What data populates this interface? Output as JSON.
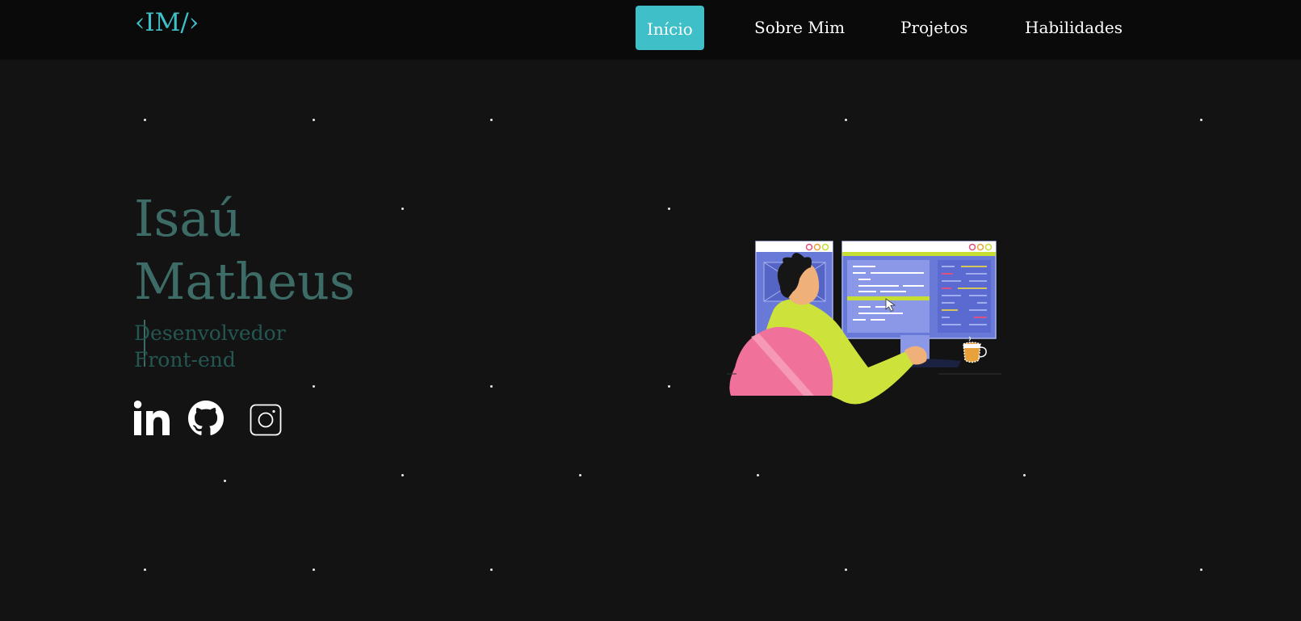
{
  "header": {
    "logo": "‹IM/›",
    "nav": [
      {
        "label": "Início",
        "active": true
      },
      {
        "label": "Sobre Mim",
        "active": false
      },
      {
        "label": "Projetos",
        "active": false
      },
      {
        "label": "Habilidades",
        "active": false
      }
    ]
  },
  "hero": {
    "name_first": "Isaú",
    "name_last": "Matheus",
    "role": "Desenvolvedor Front-end",
    "socials": [
      {
        "network": "LinkedIn",
        "icon": "linkedin-icon"
      },
      {
        "network": "GitHub",
        "icon": "github-icon"
      },
      {
        "network": "Instagram",
        "icon": "instagram-icon"
      }
    ]
  },
  "colors": {
    "accent": "#3fbfc7",
    "background": "#131313",
    "navbar": "#0a0a0a",
    "name": "#3d6b66",
    "role": "#245753"
  }
}
